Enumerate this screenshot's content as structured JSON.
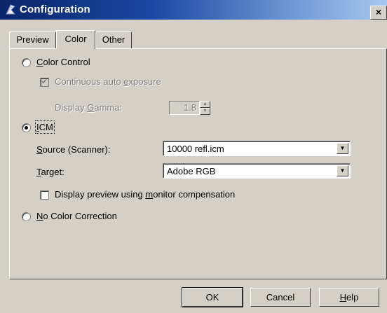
{
  "window": {
    "title": "Configuration",
    "close_glyph": "×",
    "icon": "scanner-app-icon"
  },
  "tabs": [
    {
      "label": "Preview",
      "active": false
    },
    {
      "label": "Color",
      "active": true
    },
    {
      "label": "Other",
      "active": false
    }
  ],
  "color_control": {
    "prefix": "",
    "accel": "C",
    "rest": "olor Control",
    "selected": false
  },
  "auto_exposure": {
    "label_before": "Continuous auto ",
    "accel": "e",
    "label_after": "xposure",
    "checked": true,
    "enabled": false
  },
  "display_gamma": {
    "label_before": "Display ",
    "accel": "G",
    "label_after": "amma:",
    "value": "1.8",
    "enabled": false
  },
  "icm": {
    "accel": "I",
    "rest": "CM",
    "selected": true
  },
  "source": {
    "accel": "S",
    "rest": "ource (Scanner):",
    "value": "10000 refl.icm"
  },
  "target": {
    "accel": "T",
    "rest": "arget:",
    "value": "Adobe RGB"
  },
  "monitor_compensation": {
    "label_before": "Display preview using ",
    "accel": "m",
    "label_after": "onitor compensation",
    "checked": false
  },
  "no_color_correction": {
    "accel": "N",
    "rest": "o Color Correction",
    "selected": false
  },
  "buttons": {
    "ok": "OK",
    "cancel": "Cancel",
    "help_accel": "H",
    "help_rest": "elp"
  },
  "colors": {
    "title_start": "#0a246a",
    "title_end": "#a6c8f0",
    "face": "#d4d0c8",
    "disabled_text": "#808080"
  }
}
